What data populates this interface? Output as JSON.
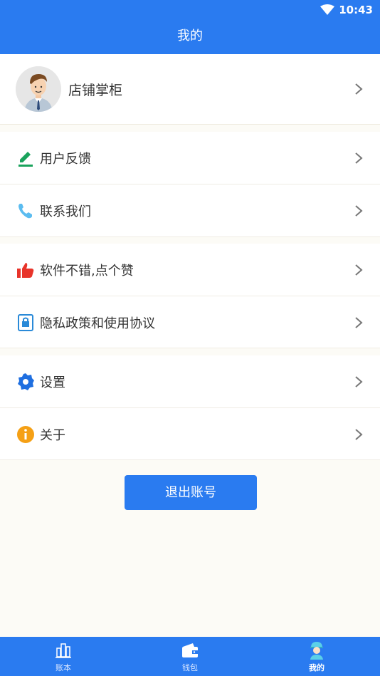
{
  "status_bar": {
    "time": "10:43"
  },
  "header": {
    "title": "我的"
  },
  "profile": {
    "name": "店铺掌柜"
  },
  "menu": [
    {
      "label": "用户反馈",
      "icon": "pencil-icon"
    },
    {
      "label": "联系我们",
      "icon": "phone-icon"
    },
    {
      "label": "软件不错,点个赞",
      "icon": "thumbs-up-icon"
    },
    {
      "label": "隐私政策和使用协议",
      "icon": "privacy-lock-icon"
    },
    {
      "label": "设置",
      "icon": "gear-icon"
    },
    {
      "label": "关于",
      "icon": "info-icon"
    }
  ],
  "logout": {
    "label": "退出账号"
  },
  "tabs": [
    {
      "label": "账本",
      "icon": "ledger-icon"
    },
    {
      "label": "钱包",
      "icon": "wallet-icon"
    },
    {
      "label": "我的",
      "icon": "profile-icon",
      "active": true
    }
  ],
  "colors": {
    "primary": "#2a7bf0",
    "background": "#fcfbf6",
    "pencil": "#1aa35c",
    "phone": "#5bbcf0",
    "thumb": "#e8342a",
    "gear": "#1f6fe0",
    "info": "#f5a015"
  }
}
